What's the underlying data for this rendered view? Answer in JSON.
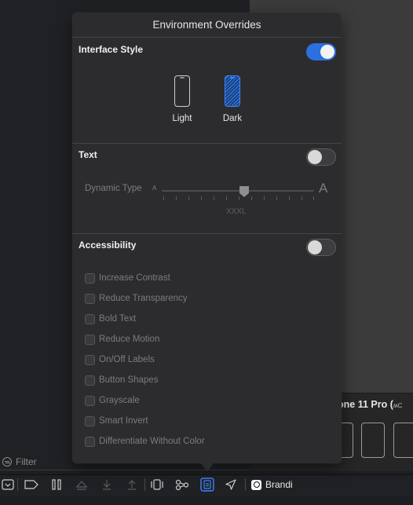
{
  "popover": {
    "title": "Environment Overrides",
    "interface_style": {
      "label": "Interface Style",
      "enabled": true,
      "options": [
        {
          "label": "Light",
          "selected": false
        },
        {
          "label": "Dark",
          "selected": true
        }
      ]
    },
    "text": {
      "label": "Text",
      "enabled": false,
      "dynamic_type_label": "Dynamic Type",
      "small_a": "A",
      "large_a": "A",
      "current_size": "XXXL"
    },
    "accessibility": {
      "label": "Accessibility",
      "enabled": false,
      "options": [
        {
          "label": "Increase Contrast",
          "checked": false
        },
        {
          "label": "Reduce Transparency",
          "checked": false
        },
        {
          "label": "Bold Text",
          "checked": false
        },
        {
          "label": "Reduce Motion",
          "checked": false
        },
        {
          "label": "On/Off Labels",
          "checked": false
        },
        {
          "label": "Button Shapes",
          "checked": false
        },
        {
          "label": "Grayscale",
          "checked": false
        },
        {
          "label": "Smart Invert",
          "checked": false
        },
        {
          "label": "Differentiate Without Color",
          "checked": false
        }
      ]
    }
  },
  "filter": {
    "placeholder": "Filter"
  },
  "device": {
    "title": "one 11 Pro (",
    "badge": "ʍC",
    "suffix": "C"
  },
  "toolbar": {
    "app_name": "Brandi"
  },
  "colors": {
    "accent": "#2b6fe0",
    "popover_bg": "#2c2c2e"
  }
}
